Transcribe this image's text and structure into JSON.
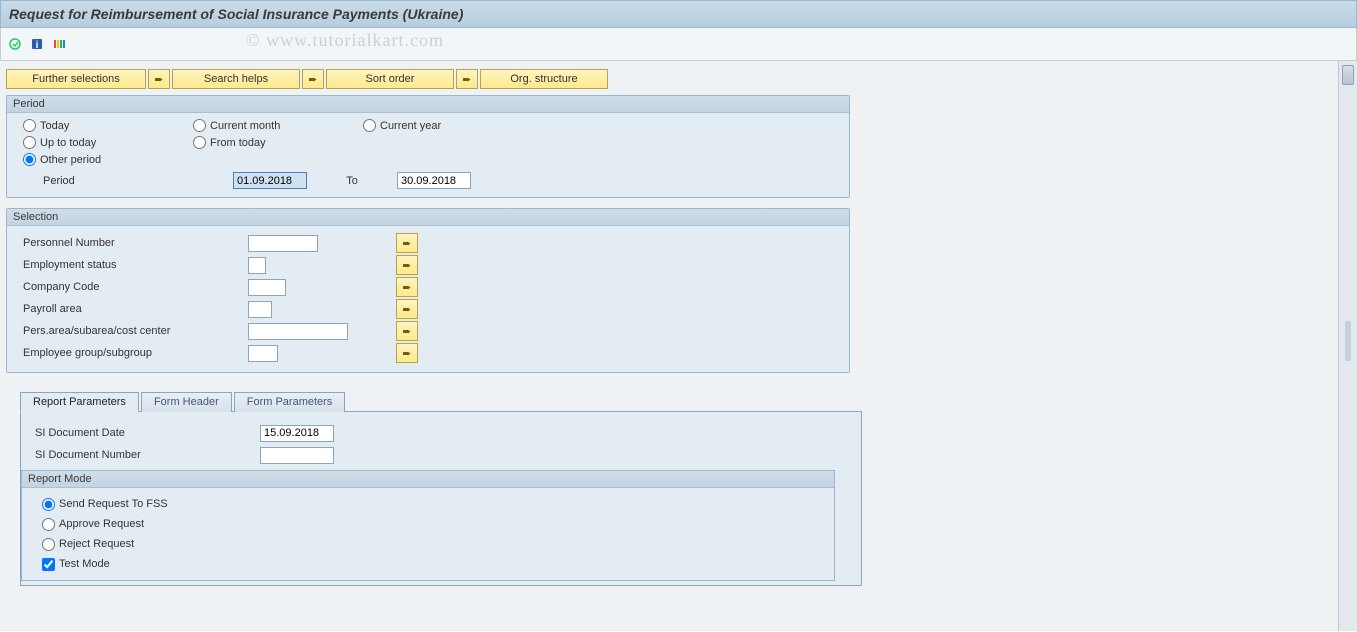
{
  "header": {
    "title": "Request for Reimbursement of Social Insurance Payments (Ukraine)"
  },
  "watermark": "© www.tutorialkart.com",
  "toolbar": {
    "icons": [
      "execute",
      "info",
      "variants"
    ]
  },
  "action_buttons": {
    "further": "Further selections",
    "search": "Search helps",
    "sort": "Sort order",
    "org": "Org. structure"
  },
  "period": {
    "legend": "Period",
    "options": {
      "today": "Today",
      "current_month": "Current month",
      "current_year": "Current year",
      "up_to_today": "Up to today",
      "from_today": "From today",
      "other": "Other period"
    },
    "selected": "other",
    "period_label": "Period",
    "from_value": "01.09.2018",
    "to_label": "To",
    "to_value": "30.09.2018"
  },
  "selection": {
    "legend": "Selection",
    "fields": {
      "pernr": "Personnel Number",
      "empstat": "Employment status",
      "company": "Company Code",
      "payroll": "Payroll area",
      "persarea": "Pers.area/subarea/cost center",
      "empgroup": "Employee group/subgroup"
    }
  },
  "tabs": {
    "report": "Report Parameters",
    "header": "Form Header",
    "form": "Form Parameters",
    "active": "report"
  },
  "report_params": {
    "doc_date_label": "SI Document Date",
    "doc_date_value": "15.09.2018",
    "doc_num_label": "SI Document Number",
    "doc_num_value": "",
    "mode_legend": "Report Mode",
    "modes": {
      "send": "Send Request To FSS",
      "approve": "Approve Request",
      "reject": "Reject Request",
      "test": "Test Mode"
    },
    "mode_selected": "send",
    "test_checked": true
  }
}
